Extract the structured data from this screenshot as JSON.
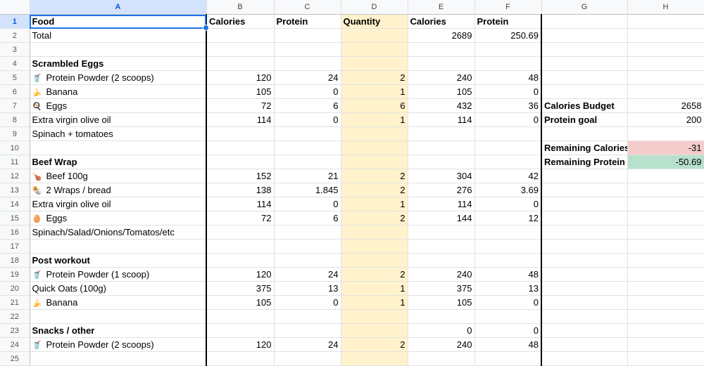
{
  "columns": [
    "A",
    "B",
    "C",
    "D",
    "E",
    "F",
    "G",
    "H"
  ],
  "rows": [
    {
      "n": "1",
      "a": "Food",
      "b": "Calories",
      "c": "Protein",
      "d": "Quantity",
      "e": "Calories",
      "f": "Protein",
      "g": "",
      "h": ""
    },
    {
      "n": "2",
      "a": "Total",
      "b": "",
      "c": "",
      "d": "",
      "e": "2689",
      "f": "250.69",
      "g": "",
      "h": ""
    },
    {
      "n": "3",
      "a": "",
      "b": "",
      "c": "",
      "d": "",
      "e": "",
      "f": "",
      "g": "",
      "h": ""
    },
    {
      "n": "4",
      "a": "Scrambled Eggs",
      "b": "",
      "c": "",
      "d": "",
      "e": "",
      "f": "",
      "g": "",
      "h": ""
    },
    {
      "n": "5",
      "icon": "🥤",
      "a": "Protein Powder (2 scoops)",
      "b": "120",
      "c": "24",
      "d": "2",
      "e": "240",
      "f": "48",
      "g": "",
      "h": ""
    },
    {
      "n": "6",
      "icon": "🍌",
      "a": "Banana",
      "b": "105",
      "c": "0",
      "d": "1",
      "e": "105",
      "f": "0",
      "g": "",
      "h": ""
    },
    {
      "n": "7",
      "icon": "🍳",
      "a": "Eggs",
      "b": "72",
      "c": "6",
      "d": "6",
      "e": "432",
      "f": "36",
      "g": "Calories Budget",
      "h": "2658"
    },
    {
      "n": "8",
      "a": "Extra virgin olive oil",
      "b": "114",
      "c": "0",
      "d": "1",
      "e": "114",
      "f": "0",
      "g": "Protein goal",
      "h": "200"
    },
    {
      "n": "9",
      "a": "Spinach + tomatoes",
      "b": "",
      "c": "",
      "d": "",
      "e": "",
      "f": "",
      "g": "",
      "h": ""
    },
    {
      "n": "10",
      "a": "",
      "b": "",
      "c": "",
      "d": "",
      "e": "",
      "f": "",
      "g": "Remaining Calories",
      "h": "-31"
    },
    {
      "n": "11",
      "a": "Beef Wrap",
      "b": "",
      "c": "",
      "d": "",
      "e": "",
      "f": "",
      "g": "Remaining Protein",
      "h": "-50.69"
    },
    {
      "n": "12",
      "icon": "🍗",
      "a": "Beef 100g",
      "b": "152",
      "c": "21",
      "d": "2",
      "e": "304",
      "f": "42",
      "g": "",
      "h": ""
    },
    {
      "n": "13",
      "icon": "🌯",
      "a": "2 Wraps / bread",
      "b": "138",
      "c": "1.845",
      "d": "2",
      "e": "276",
      "f": "3.69",
      "g": "",
      "h": ""
    },
    {
      "n": "14",
      "a": "Extra virgin olive oil",
      "b": "114",
      "c": "0",
      "d": "1",
      "e": "114",
      "f": "0",
      "g": "",
      "h": ""
    },
    {
      "n": "15",
      "icon": "🥚",
      "a": "Eggs",
      "b": "72",
      "c": "6",
      "d": "2",
      "e": "144",
      "f": "12",
      "g": "",
      "h": ""
    },
    {
      "n": "16",
      "a": "Spinach/Salad/Onions/Tomatos/etc",
      "b": "",
      "c": "",
      "d": "",
      "e": "",
      "f": "",
      "g": "",
      "h": ""
    },
    {
      "n": "17",
      "a": "",
      "b": "",
      "c": "",
      "d": "",
      "e": "",
      "f": "",
      "g": "",
      "h": ""
    },
    {
      "n": "18",
      "a": "Post workout",
      "b": "",
      "c": "",
      "d": "",
      "e": "",
      "f": "",
      "g": "",
      "h": ""
    },
    {
      "n": "19",
      "icon": "🥤",
      "a": "Protein Powder (1 scoop)",
      "b": "120",
      "c": "24",
      "d": "2",
      "e": "240",
      "f": "48",
      "g": "",
      "h": ""
    },
    {
      "n": "20",
      "a": "Quick Oats (100g)",
      "b": "375",
      "c": "13",
      "d": "1",
      "e": "375",
      "f": "13",
      "g": "",
      "h": ""
    },
    {
      "n": "21",
      "icon": "🍌",
      "a": "Banana",
      "b": "105",
      "c": "0",
      "d": "1",
      "e": "105",
      "f": "0",
      "g": "",
      "h": ""
    },
    {
      "n": "22",
      "a": "",
      "b": "",
      "c": "",
      "d": "",
      "e": "",
      "f": "",
      "g": "",
      "h": ""
    },
    {
      "n": "23",
      "a": "Snacks / other",
      "b": "",
      "c": "",
      "d": "",
      "e": "0",
      "f": "0",
      "g": "",
      "h": ""
    },
    {
      "n": "24",
      "icon": "🥤",
      "a": "Protein Powder (2 scoops)",
      "b": "120",
      "c": "24",
      "d": "2",
      "e": "240",
      "f": "48",
      "g": "",
      "h": ""
    },
    {
      "n": "25",
      "a": "",
      "b": "",
      "c": "",
      "d": "",
      "e": "",
      "f": "",
      "g": "",
      "h": ""
    }
  ],
  "bold_a_rows": [
    "1",
    "4",
    "11",
    "18",
    "23"
  ],
  "bold_header_row": "1",
  "bold_g_rows": [
    "7",
    "8",
    "10",
    "11"
  ],
  "colors": {
    "quantity_fill": "#fff2cc",
    "remaining_calories_fill": "#f4cccc",
    "remaining_protein_fill": "#b7e1cd",
    "selection": "#1a73e8"
  }
}
